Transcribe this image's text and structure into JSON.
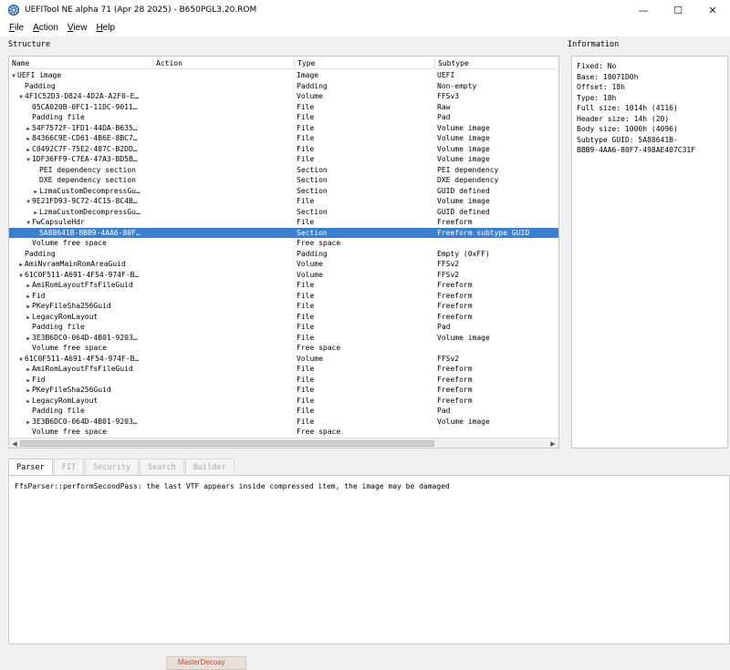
{
  "window": {
    "title": "UEFITool NE alpha 71 (Apr 28 2025) - B650PGL3.20.ROM",
    "minimize": "—",
    "maximize": "☐",
    "close": "✕"
  },
  "menu": [
    {
      "label": "File",
      "ul": "F",
      "rest": "ile"
    },
    {
      "label": "Action",
      "ul": "A",
      "rest": "ction"
    },
    {
      "label": "View",
      "ul": "V",
      "rest": "iew"
    },
    {
      "label": "Help",
      "ul": "H",
      "rest": "elp"
    }
  ],
  "structure": {
    "label": "Structure",
    "columns": {
      "name": "Name",
      "action": "Action",
      "type": "Type",
      "subtype": "Subtype"
    },
    "rows": [
      {
        "indent": 0,
        "arrow": "down",
        "name": "UEFI image",
        "type": "Image",
        "subtype": "UEFI"
      },
      {
        "indent": 1,
        "arrow": "",
        "name": "Padding",
        "type": "Padding",
        "subtype": "Non-empty"
      },
      {
        "indent": 1,
        "arrow": "down",
        "name": "4F1C52D3-D824-4D2A-A2F0-E…",
        "type": "Volume",
        "subtype": "FFSv3"
      },
      {
        "indent": 2,
        "arrow": "",
        "name": "05CA020B-0FC1-11DC-9011…",
        "type": "File",
        "subtype": "Raw"
      },
      {
        "indent": 2,
        "arrow": "",
        "name": "Padding file",
        "type": "File",
        "subtype": "Pad"
      },
      {
        "indent": 2,
        "arrow": "right",
        "name": "54F7572F-1FD1-44DA-B635…",
        "type": "File",
        "subtype": "Volume image"
      },
      {
        "indent": 2,
        "arrow": "right",
        "name": "84366C9E-CD61-4B6E-8BC7…",
        "type": "File",
        "subtype": "Volume image"
      },
      {
        "indent": 2,
        "arrow": "right",
        "name": "C0492C7F-75E2-487C-B2DD…",
        "type": "File",
        "subtype": "Volume image"
      },
      {
        "indent": 2,
        "arrow": "down",
        "name": "1DF36FF9-C7EA-47A3-BD5B…",
        "type": "File",
        "subtype": "Volume image"
      },
      {
        "indent": 3,
        "arrow": "",
        "name": "PEI dependency section",
        "type": "Section",
        "subtype": "PEI dependency"
      },
      {
        "indent": 3,
        "arrow": "",
        "name": "DXE dependency section",
        "type": "Section",
        "subtype": "DXE dependency"
      },
      {
        "indent": 3,
        "arrow": "right",
        "name": "LzmaCustomDecompressGu…",
        "type": "Section",
        "subtype": "GUID defined"
      },
      {
        "indent": 2,
        "arrow": "down",
        "name": "9E21FD93-9C72-4C15-8C4B…",
        "type": "File",
        "subtype": "Volume image"
      },
      {
        "indent": 3,
        "arrow": "right",
        "name": "LzmaCustomDecompressGu…",
        "type": "Section",
        "subtype": "GUID defined"
      },
      {
        "indent": 2,
        "arrow": "down",
        "name": "FwCapsuleHdr",
        "type": "File",
        "subtype": "Freeform"
      },
      {
        "indent": 3,
        "arrow": "",
        "name": "5A88641B-BBB9-4AA6-80F…",
        "type": "Section",
        "subtype": "Freeform subtype GUID",
        "selected": true
      },
      {
        "indent": 2,
        "arrow": "",
        "name": "Volume free space",
        "type": "Free space",
        "subtype": ""
      },
      {
        "indent": 1,
        "arrow": "",
        "name": "Padding",
        "type": "Padding",
        "subtype": "Empty (0xFF)"
      },
      {
        "indent": 1,
        "arrow": "right",
        "name": "AmiNvramMainRomAreaGuid",
        "type": "Volume",
        "subtype": "FFSv2"
      },
      {
        "indent": 1,
        "arrow": "down",
        "name": "61C0F511-A691-4F54-974F-B…",
        "type": "Volume",
        "subtype": "FFSv2"
      },
      {
        "indent": 2,
        "arrow": "right",
        "name": "AmiRomLayoutFfsFileGuid",
        "type": "File",
        "subtype": "Freeform"
      },
      {
        "indent": 2,
        "arrow": "right",
        "name": "Fid",
        "type": "File",
        "subtype": "Freeform"
      },
      {
        "indent": 2,
        "arrow": "right",
        "name": "PKeyFileSha256Guid",
        "type": "File",
        "subtype": "Freeform"
      },
      {
        "indent": 2,
        "arrow": "right",
        "name": "LegacyRomLayout",
        "type": "File",
        "subtype": "Freeform"
      },
      {
        "indent": 2,
        "arrow": "",
        "name": "Padding file",
        "type": "File",
        "subtype": "Pad"
      },
      {
        "indent": 2,
        "arrow": "right",
        "name": "3E3B6DC0-064D-4B01-9203…",
        "type": "File",
        "subtype": "Volume image"
      },
      {
        "indent": 2,
        "arrow": "",
        "name": "Volume free space",
        "type": "Free space",
        "subtype": ""
      },
      {
        "indent": 1,
        "arrow": "down",
        "name": "61C0F511-A691-4F54-974F-B…",
        "type": "Volume",
        "subtype": "FFSv2"
      },
      {
        "indent": 2,
        "arrow": "right",
        "name": "AmiRomLayoutFfsFileGuid",
        "type": "File",
        "subtype": "Freeform"
      },
      {
        "indent": 2,
        "arrow": "right",
        "name": "Fid",
        "type": "File",
        "subtype": "Freeform"
      },
      {
        "indent": 2,
        "arrow": "right",
        "name": "PKeyFileSha256Guid",
        "type": "File",
        "subtype": "Freeform"
      },
      {
        "indent": 2,
        "arrow": "right",
        "name": "LegacyRomLayout",
        "type": "File",
        "subtype": "Freeform"
      },
      {
        "indent": 2,
        "arrow": "",
        "name": "Padding file",
        "type": "File",
        "subtype": "Pad"
      },
      {
        "indent": 2,
        "arrow": "right",
        "name": "3E3B6DC0-064D-4B01-9203…",
        "type": "File",
        "subtype": "Volume image"
      },
      {
        "indent": 2,
        "arrow": "",
        "name": "Volume free space",
        "type": "Free space",
        "subtype": ""
      }
    ]
  },
  "information": {
    "label": "Information",
    "lines": [
      "Fixed: No",
      "Base: 18071D0h",
      "Offset: 18h",
      "Type: 18h",
      "Full size: 1014h (4116)",
      "Header size: 14h (20)",
      "Body size: 1000h (4096)",
      "Subtype GUID: 5A88641B-",
      "BBB9-4AA6-80F7-498AE407C31F"
    ]
  },
  "tabs": [
    {
      "label": "Parser",
      "active": true
    },
    {
      "label": "FIT",
      "active": false
    },
    {
      "label": "Security",
      "active": false
    },
    {
      "label": "Search",
      "active": false
    },
    {
      "label": "Builder",
      "active": false
    }
  ],
  "messages": [
    "FfsParser::performSecondPass: the last VTF appears inside compressed item, the image may be damaged"
  ],
  "taskbar_fragment": "MasterDecoay"
}
